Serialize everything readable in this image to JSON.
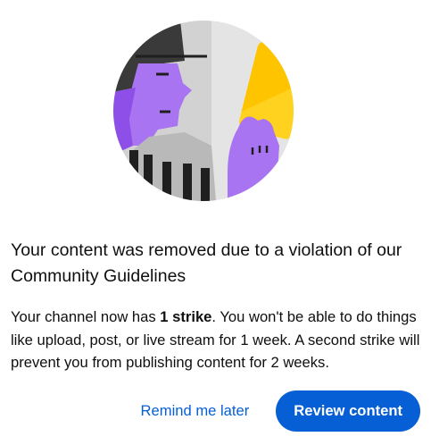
{
  "dialog": {
    "title": "Your content was removed due to a violation of our Community Guidelines",
    "body_prefix": "Your channel now has ",
    "body_strike": "1 strike",
    "body_suffix": ". You won't be able to do things like upload, post, or live stream for 1 week. A second strike will prevent you from publishing content for 2 weeks.",
    "remind_label": "Remind me later",
    "review_label": "Review content"
  },
  "colors": {
    "accent": "#065fd4",
    "referee_purple": "#9b5de5",
    "card_yellow": "#ffc400",
    "cap_dark": "#3d3d3d",
    "background_gray": "#c6c6c6"
  },
  "icons": {
    "illustration": "referee-yellow-card-illustration"
  }
}
